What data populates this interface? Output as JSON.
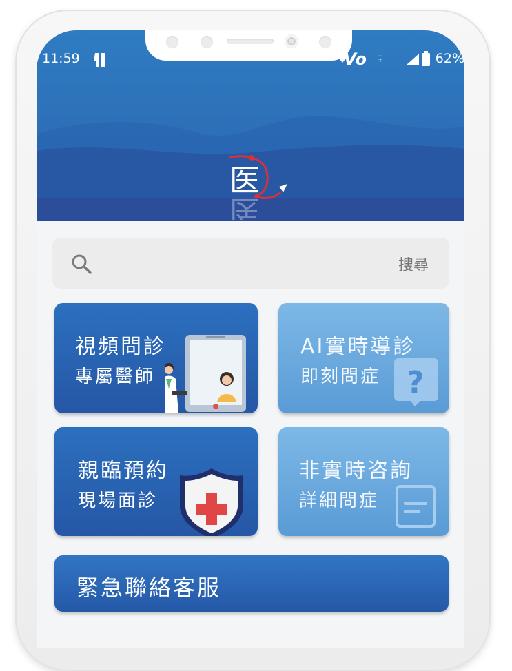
{
  "status_bar": {
    "time": "11:59",
    "network_label": "Vo",
    "lte_label": "LTE",
    "battery_percent": "62%"
  },
  "search": {
    "placeholder": "搜尋"
  },
  "cards": [
    {
      "title": "視頻問診",
      "subtitle": "專屬醫師",
      "style": "dark",
      "icon": "doctor-video-call-illustration"
    },
    {
      "title": "AI實時導診",
      "subtitle": "即刻問症",
      "style": "light",
      "icon": "question-bubble-icon"
    },
    {
      "title": "親臨預約",
      "subtitle": "現場面診",
      "style": "dark",
      "icon": "medical-shield-icon"
    },
    {
      "title": "非實時咨詢",
      "subtitle": "詳細問症",
      "style": "light",
      "icon": "message-box-icon"
    }
  ],
  "emergency": {
    "label": "緊急聯絡客服"
  },
  "colors": {
    "primary_blue": "#2a63b0",
    "light_blue": "#6aa9df",
    "logo_red": "#d6323a"
  }
}
